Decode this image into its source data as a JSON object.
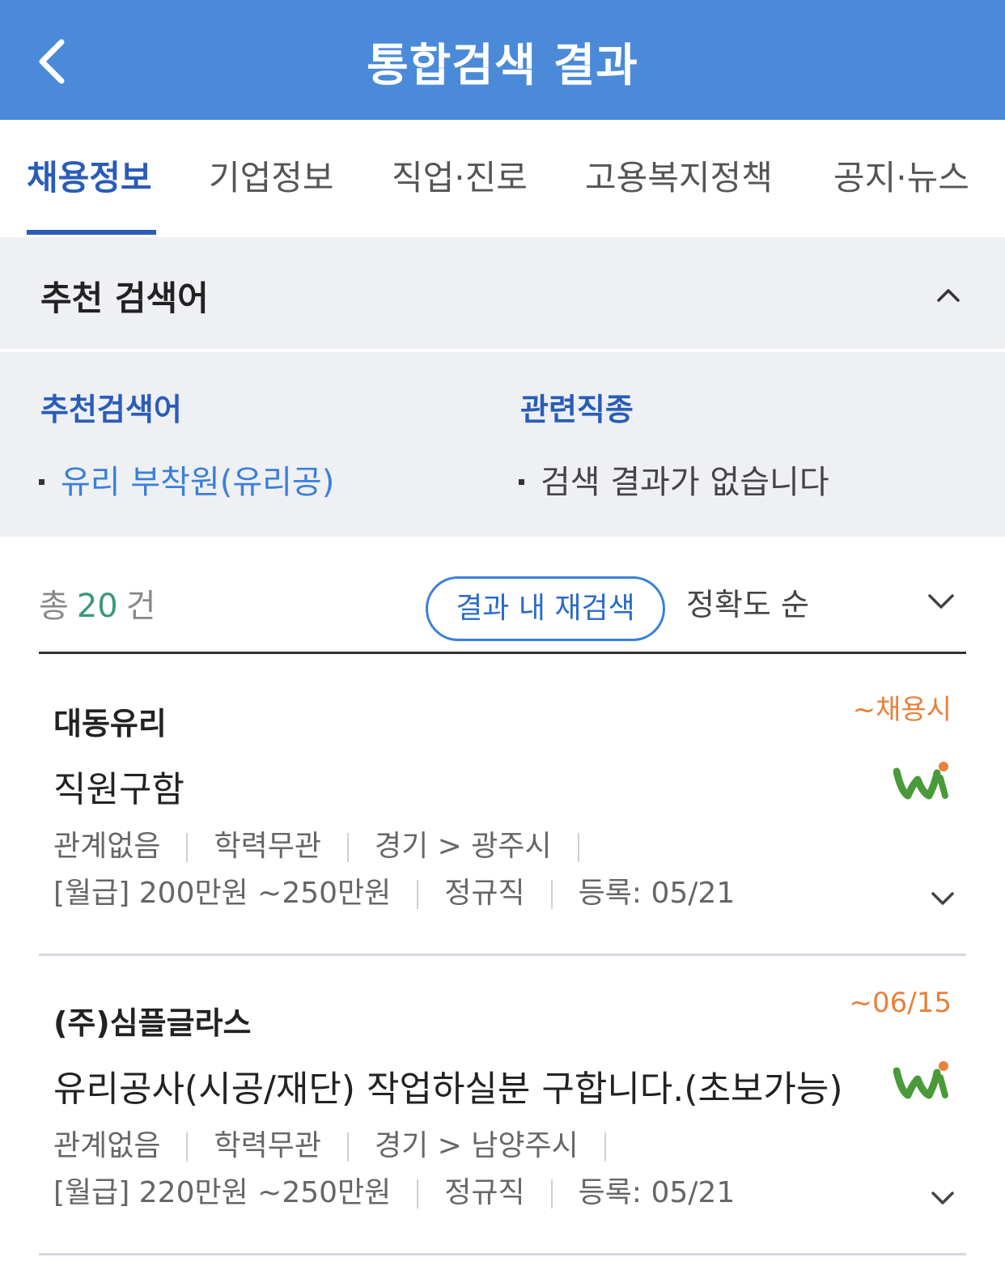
{
  "header": {
    "title": "통합검색 결과",
    "back_icon": "chevron-left-icon"
  },
  "tabs": [
    {
      "label": "채용정보",
      "active": true
    },
    {
      "label": "기업정보",
      "active": false
    },
    {
      "label": "직업·진로",
      "active": false
    },
    {
      "label": "고용복지정책",
      "active": false
    },
    {
      "label": "공지·뉴스",
      "active": false
    }
  ],
  "recommend": {
    "section_title": "추천 검색어",
    "col1_title": "추천검색어",
    "col1_item": "유리 부착원(유리공)",
    "col2_title": "관련직종",
    "col2_item": "검색 결과가 없습니다"
  },
  "results": {
    "total_prefix": "총",
    "total_count": "20",
    "total_suffix": "건",
    "research_button": "결과 내 재검색",
    "sort_label": "정확도 순"
  },
  "jobs": [
    {
      "company": "대동유리",
      "deadline": "~채용시",
      "title": "직원구함",
      "experience": "관계없음",
      "education": "학력무관",
      "location": "경기 > 광주시",
      "salary": "[월급] 200만원 ~250만원",
      "type": "정규직",
      "registered": "등록: 05/21"
    },
    {
      "company": "(주)심플글라스",
      "deadline": "~06/15",
      "title": "유리공사(시공/재단) 작업하실분 구합니다.(초보가능)",
      "experience": "관계없음",
      "education": "학력무관",
      "location": "경기 > 남양주시",
      "salary": "[월급] 220만원 ~250만원",
      "type": "정규직",
      "registered": "등록: 05/21"
    }
  ],
  "colors": {
    "header_bg": "#4a8ad8",
    "active_tab": "#2a5cb8",
    "link": "#3a7fd8",
    "count": "#3a9a78",
    "deadline": "#e8813a",
    "panel_bg": "#eef0f4"
  }
}
